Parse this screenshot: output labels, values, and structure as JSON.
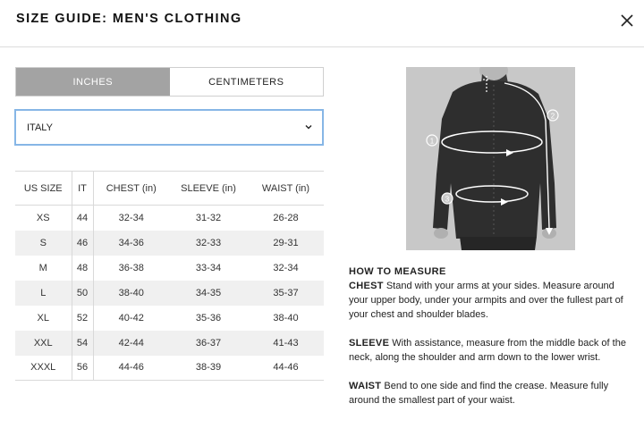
{
  "header": {
    "title": "SIZE GUIDE: MEN'S CLOTHING"
  },
  "units": [
    {
      "label": "INCHES",
      "active": true
    },
    {
      "label": "CENTIMETERS",
      "active": false
    }
  ],
  "country_select": {
    "value": "ITALY"
  },
  "size_table": {
    "headers": [
      "US SIZE",
      "IT",
      "CHEST (in)",
      "SLEEVE (in)",
      "WAIST (in)"
    ],
    "rows": [
      [
        "XS",
        "44",
        "32-34",
        "31-32",
        "26-28"
      ],
      [
        "S",
        "46",
        "34-36",
        "32-33",
        "29-31"
      ],
      [
        "M",
        "48",
        "36-38",
        "33-34",
        "32-34"
      ],
      [
        "L",
        "50",
        "38-40",
        "34-35",
        "35-37"
      ],
      [
        "XL",
        "52",
        "40-42",
        "35-36",
        "38-40"
      ],
      [
        "XXL",
        "54",
        "42-44",
        "36-37",
        "41-43"
      ],
      [
        "XXXL",
        "56",
        "44-46",
        "38-39",
        "44-46"
      ]
    ]
  },
  "figure": {
    "markers": [
      "1",
      "2",
      "3"
    ]
  },
  "how_to_measure": {
    "heading": "HOW TO MEASURE",
    "chest": {
      "label": "CHEST",
      "text": " Stand with your arms at your sides. Measure around your upper body, under your armpits and over the fullest part of your chest and shoulder blades."
    },
    "sleeve": {
      "label": "SLEEVE",
      "text": " With assistance, measure from the middle back of the neck, along the shoulder and arm down to the lower wrist."
    },
    "waist": {
      "label": "WAIST",
      "text": " Bend to one side and find the crease. Measure fully around the smallest part of your waist."
    }
  },
  "colors": {
    "active_tab": "#a3a3a3",
    "select_border": "#86b6e6",
    "row_stripe": "#f0f0f0"
  }
}
